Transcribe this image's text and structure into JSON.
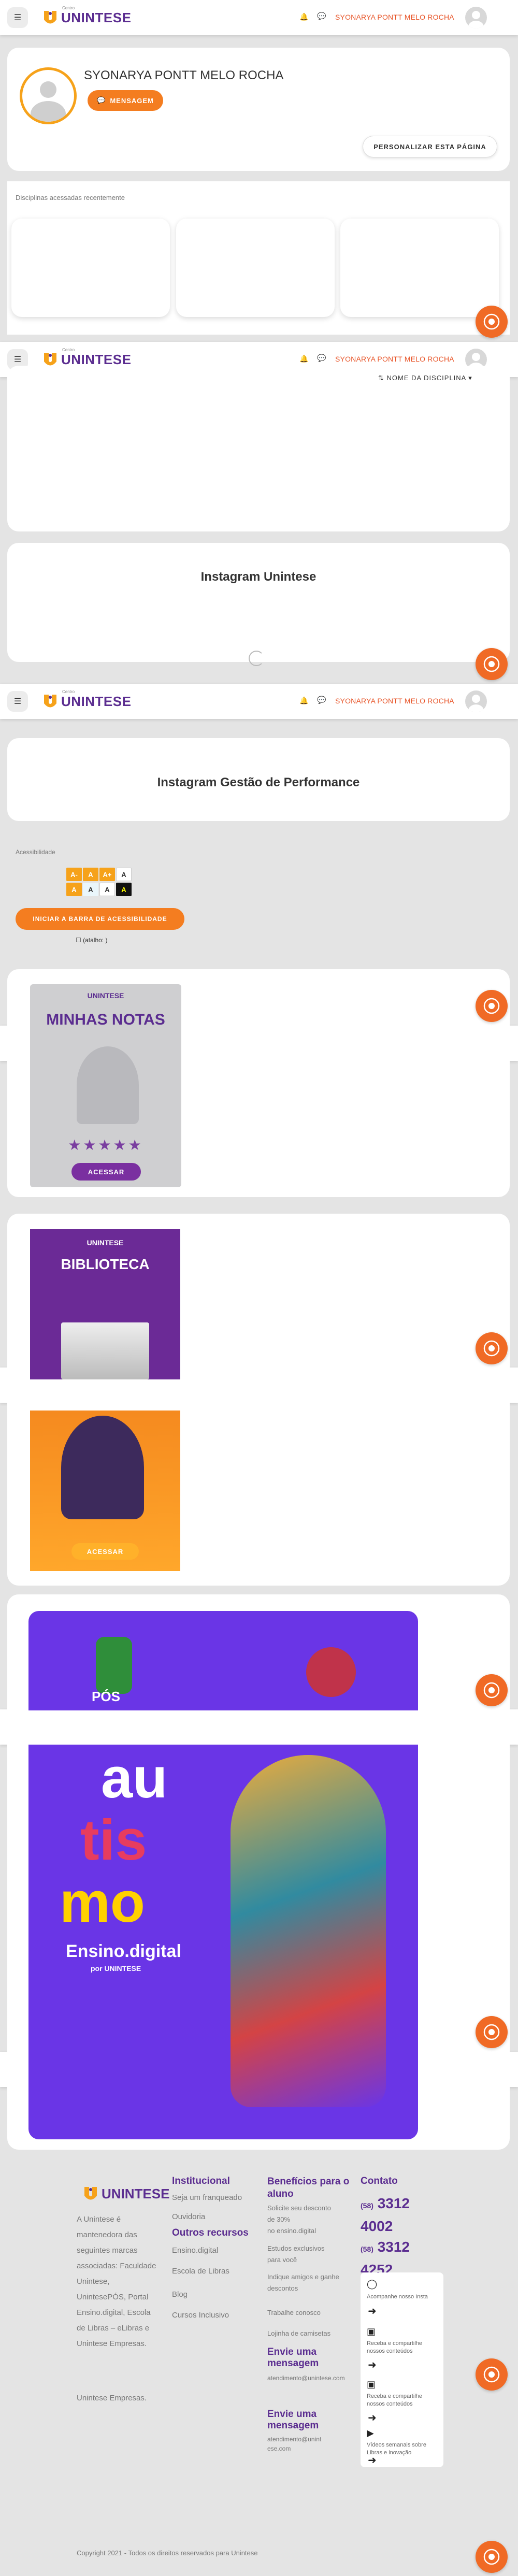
{
  "colors": {
    "brand_purple": "#5b2d90",
    "accent_orange": "#f47d20",
    "fab_orange": "#f06a25"
  },
  "navbar": {
    "menu_icon": "hamburger-icon",
    "logo_text": "UNINTESE",
    "logo_small": "Centro",
    "bell_icon": "bell-icon",
    "chat_icon": "chat-icon",
    "user_name": "SYONARYA PONTT MELO ROCHA"
  },
  "profile": {
    "name": "SYONARYA PONTT MELO ROCHA",
    "message_button": "MENSAGEM",
    "customize_button": "PERSONALIZAR ESTA PÁGINA"
  },
  "recent_courses": {
    "label": "Disciplinas acessadas recentemente"
  },
  "course_sort": {
    "label": "NOME DA DISCIPLINA"
  },
  "instagram": {
    "title_1": "Instagram Unintese",
    "title_2": "Instagram Gestão de Performance"
  },
  "accessibility": {
    "label": "Acessibilidade",
    "buttons": [
      "A-",
      "A",
      "A+",
      "A",
      "A",
      "A"
    ],
    "start_button": "INICIAR A BARRA DE ACESSIBILIDADE",
    "checkbox_label": "(atalho: )"
  },
  "banners": {
    "notas_brand": "UNINTESE",
    "notas_title": "MINHAS NOTAS",
    "notas_button": "ACESSAR",
    "biblioteca_brand": "UNINTESE",
    "biblioteca_title": "BIBLIOTECA",
    "enem_button": "ACESSAR",
    "pos_text": "PÓS",
    "autismo_words": [
      "au",
      "tis",
      "mo"
    ],
    "ensino_digital": "Ensino.digital",
    "ensino_brand": "por UNINTESE"
  },
  "footer": {
    "logo_text": "UNINTESE",
    "about": [
      "A Unintese é",
      "mantenedora das",
      "seguintes marcas",
      "associadas: Faculdade",
      "Unintese,",
      "UnintesePÓS, Portal",
      "Ensino.digital, Escola",
      "de Libras – eLibras e",
      "Unintese Empresas."
    ],
    "about_extra": "Unintese Empresas.",
    "institucional_title": "Institucional",
    "institucional_items": [
      "Seja um franqueado",
      "Ouvidoria"
    ],
    "outros_title": "Outros recursos",
    "outros_items": [
      "Ensino.digital",
      "Escola de Libras",
      "Blog",
      "Cursos Inclusivo"
    ],
    "beneficios_title": "Benefícios para o aluno",
    "beneficios_items": [
      "Solicite seu desconto",
      "de 30%",
      "no ensino.digital",
      "Estudos exclusivos",
      "para você",
      "Indique amigos e ganhe",
      "descontos",
      "Trabalhe conosco",
      "Lojinha de camisetas"
    ],
    "envie_title": "Envie uma mensagem",
    "envie_email": "atendimento@unintese.com",
    "envie_title_2": "Envie uma mensagem",
    "envie_email_2": "atendimento@unintese.com",
    "contato_title": "Contato",
    "phone_1_ddd": "(58)",
    "phone_1": "3312",
    "phone_1b": "4002",
    "phone_2_ddd": "(58)",
    "phone_2": "3312",
    "phone_2b": "4252",
    "social": [
      {
        "icon": "instagram-icon",
        "text": "Acompanhe nosso Insta"
      },
      {
        "icon": "facebook-icon",
        "text": "Receba e compartilhe nossos conteúdos"
      },
      {
        "icon": "facebook-icon",
        "text": "Receba e compartilhe nossos conteúdos"
      },
      {
        "icon": "youtube-icon",
        "text": "Vídeos semanais sobre Libras e inovação"
      }
    ],
    "copyright": "Copyright 2021 - Todos os direitos reservados para Unintese"
  }
}
